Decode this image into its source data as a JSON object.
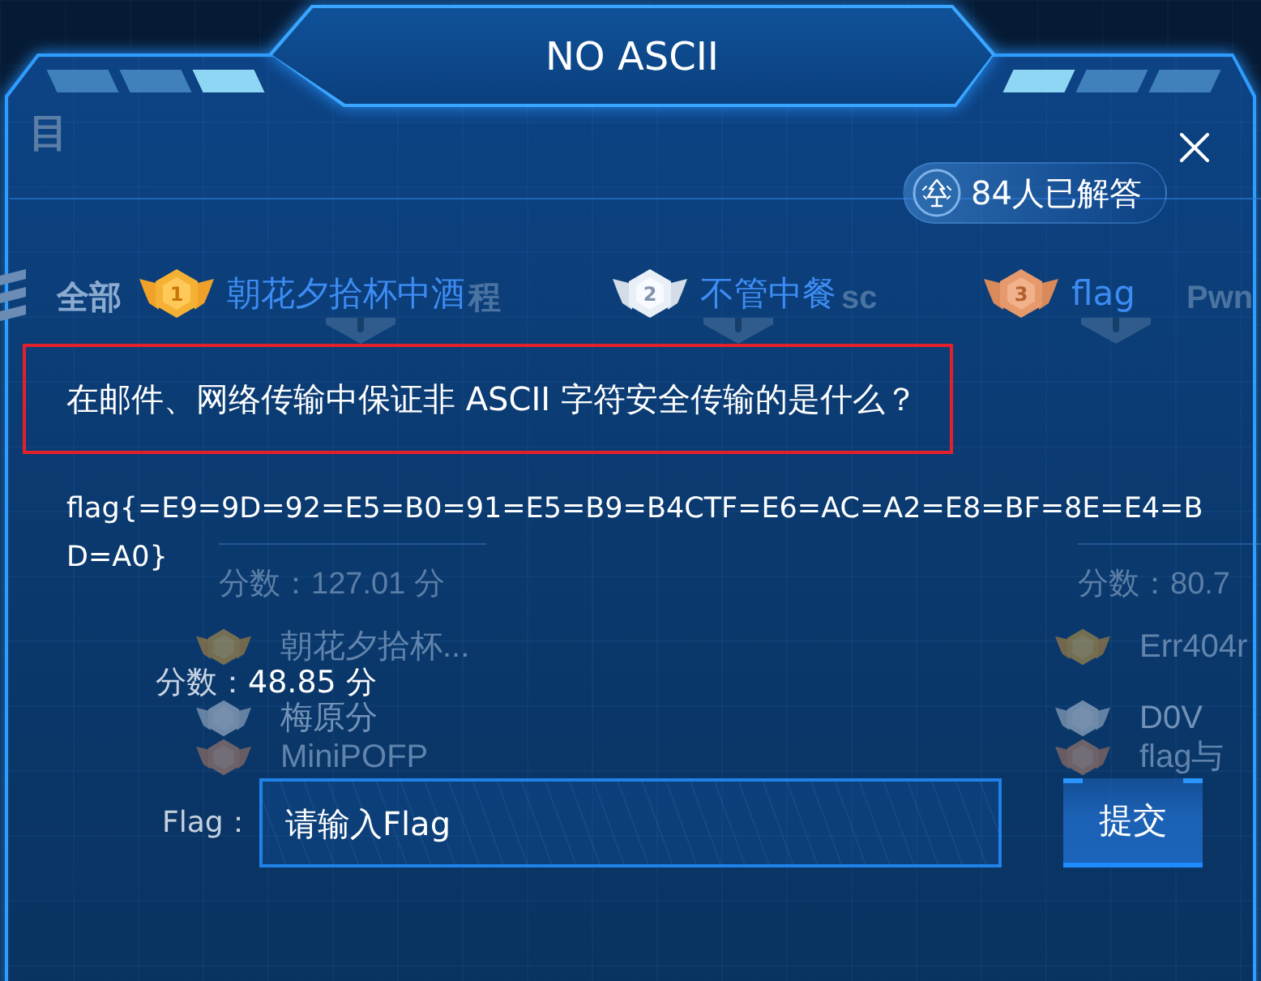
{
  "page": {
    "title": "目",
    "categories": [
      {
        "label": "全部",
        "kind": "all",
        "selected": true
      },
      {
        "label": "程",
        "kind": "topic",
        "selected": false
      },
      {
        "label": "sc",
        "kind": "topic",
        "selected": false
      },
      {
        "label": "Pwn",
        "kind": "topic",
        "selected": false
      }
    ],
    "challenges": [
      {
        "score": "分数：127.01 分",
        "solvers": [
          {
            "kind": "gold",
            "name": "朝花夕拾杯..."
          },
          {
            "kind": "silver",
            "name": "梅原分"
          },
          {
            "kind": "bronze",
            "name": "MiniPOFP"
          }
        ]
      },
      {
        "score": "分数：80.7",
        "solvers": [
          {
            "kind": "gold",
            "name": "Err404r"
          },
          {
            "kind": "silver",
            "name": "D0V"
          },
          {
            "kind": "bronze",
            "name": "flag与"
          }
        ]
      }
    ]
  },
  "dialog": {
    "title": "NO ASCII",
    "solved_count": "84人已解答",
    "top_solvers": [
      {
        "rank": "1",
        "kind": "gold",
        "name": "朝花夕拾杯中酒"
      },
      {
        "rank": "2",
        "kind": "silver",
        "name": "不管中餐"
      },
      {
        "rank": "3",
        "kind": "bronze",
        "name": "flag"
      }
    ],
    "question": "在邮件、网络传输中保证非 ASCII 字符安全传输的是什么？",
    "hint": "flag{=E9=9D=92=E5=B0=91=E5=B9=B4CTF=E6=AC=A2=E8=BF=8E=E4=BD=A0}",
    "score_label": "分数：",
    "score_value": "48.85 分",
    "flag_label": "Flag：",
    "flag_input": {
      "placeholder": "请输入Flag"
    },
    "submit_label": "提交"
  }
}
